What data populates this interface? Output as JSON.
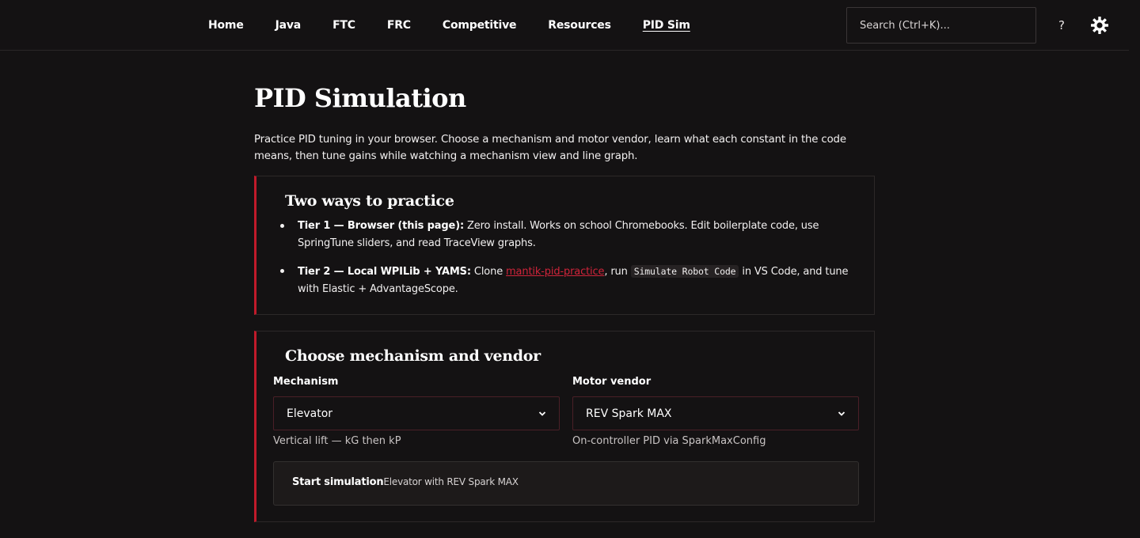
{
  "nav": {
    "items": [
      {
        "label": "Home"
      },
      {
        "label": "Java"
      },
      {
        "label": "FTC"
      },
      {
        "label": "FRC"
      },
      {
        "label": "Competitive"
      },
      {
        "label": "Resources"
      },
      {
        "label": "PID Sim",
        "active": true
      }
    ],
    "search_placeholder": "Search (Ctrl+K)...",
    "help_label": "?"
  },
  "page": {
    "title": "PID Simulation",
    "intro": "Practice PID tuning in your browser. Choose a mechanism and motor vendor, learn what each constant in the code means, then tune gains while watching a mechanism view and line graph."
  },
  "practice": {
    "heading": "Two ways to practice",
    "tier1_bold": "Tier 1 — Browser (this page):",
    "tier1_text": " Zero install. Works on school Chromebooks. Edit boilerplate code, use SpringTune sliders, and read TraceView graphs.",
    "tier2_bold": "Tier 2 — Local WPILib + YAMS:",
    "tier2_pre": " Clone ",
    "tier2_link": "mantik-pid-practice",
    "tier2_mid": ", run ",
    "tier2_code": "Simulate Robot Code",
    "tier2_post": " in VS Code, and tune with Elastic + AdvantageScope."
  },
  "chooser": {
    "heading": "Choose mechanism and vendor",
    "mechanism_label": "Mechanism",
    "mechanism_value": "Elevator",
    "mechanism_hint": "Vertical lift — kG then kP",
    "vendor_label": "Motor vendor",
    "vendor_value": "REV Spark MAX",
    "vendor_hint": "On-controller PID via SparkMaxConfig",
    "start_label": "Start simulation",
    "start_sub": "Elevator with REV Spark MAX"
  },
  "colors": {
    "accent": "#c01a2a",
    "link": "#d0243a",
    "background": "#141213"
  },
  "icons": {
    "theme": "sun-gear-icon",
    "select": "chevron-down-icon"
  }
}
